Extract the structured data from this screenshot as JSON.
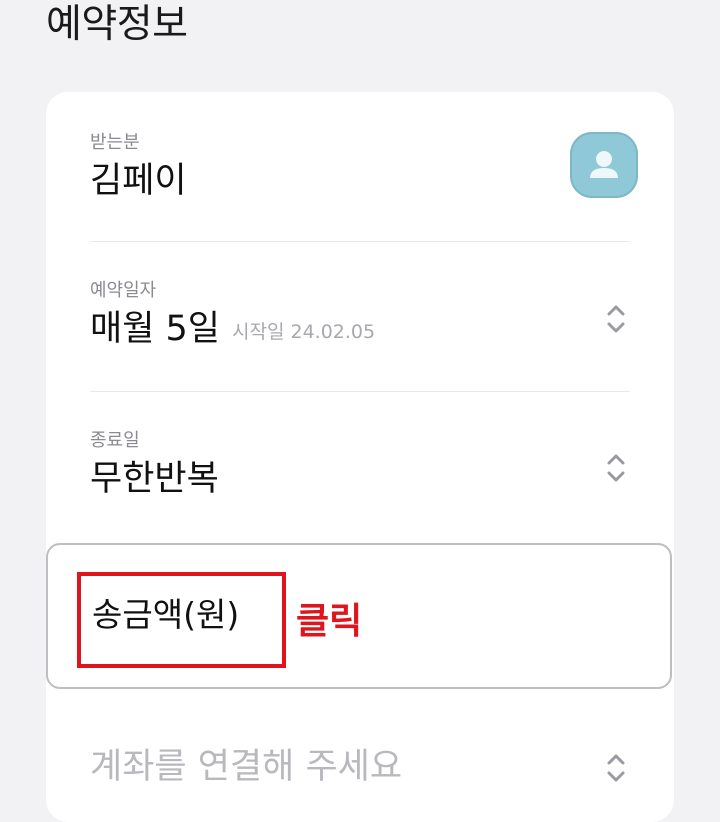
{
  "page": {
    "title": "예약정보"
  },
  "recipient": {
    "label": "받는분",
    "value": "김페이",
    "avatar_icon": "person-icon"
  },
  "reservation_date": {
    "label": "예약일자",
    "value": "매월 5일",
    "sub": "시작일 24.02.05",
    "icon": "chevron-up-down-icon"
  },
  "end_date": {
    "label": "종료일",
    "value": "무한반복",
    "icon": "chevron-up-down-icon"
  },
  "amount": {
    "label": "송금액(원)"
  },
  "annotation": {
    "text": "클릭",
    "color": "#e0141c"
  },
  "account": {
    "placeholder": "계좌를 연결해 주세요",
    "icon": "chevron-up-down-icon"
  },
  "colors": {
    "background": "#f2f2f4",
    "card": "#ffffff",
    "avatar": "#8fc8d6",
    "highlight": "#e0141c"
  }
}
